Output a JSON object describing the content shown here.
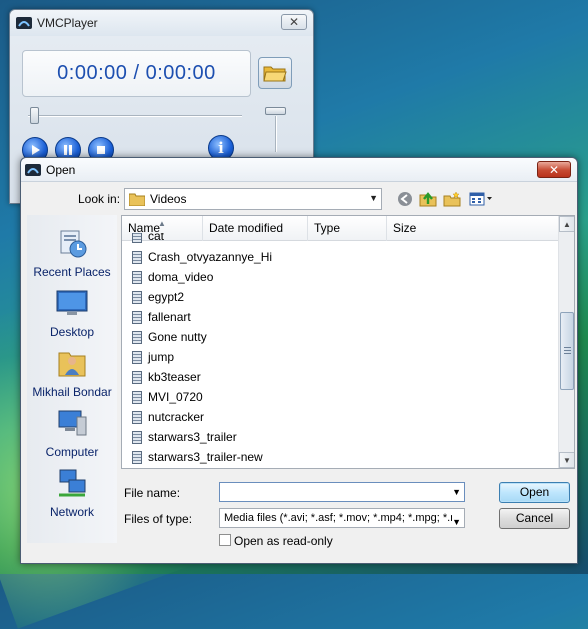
{
  "player": {
    "title": "VMCPlayer",
    "close_label": "✕",
    "time_display": "0:00:00 / 0:00:00",
    "seek_position": 0,
    "volume_level": 1.0,
    "info_label": "i",
    "controls": [
      "play-icon",
      "pause-icon",
      "stop-icon",
      "info-icon",
      "open-folder-icon"
    ]
  },
  "dialog": {
    "title": "Open",
    "close_label": "✕",
    "look_in_label": "Look in:",
    "look_in_value": "Videos",
    "places": [
      {
        "label": "Recent Places",
        "icon": "recent-places-icon"
      },
      {
        "label": "Desktop",
        "icon": "desktop-icon"
      },
      {
        "label": "Mikhail Bondar",
        "icon": "user-folder-icon"
      },
      {
        "label": "Computer",
        "icon": "computer-icon"
      },
      {
        "label": "Network",
        "icon": "network-icon"
      }
    ],
    "columns": [
      "Name",
      "Date modified",
      "Type",
      "Size"
    ],
    "files": [
      "cat",
      "Crash_otvyazannye_Hi",
      "doma_video",
      "egypt2",
      "fallenart",
      "Gone nutty",
      "jump",
      "kb3teaser",
      "MVI_0720",
      "nutcracker",
      "starwars3_trailer",
      "starwars3_trailer-new"
    ],
    "file_name_label": "File name:",
    "file_name_value": "",
    "files_of_type_label": "Files of type:",
    "files_of_type_value": "Media files (*.avi; *.asf; *.mov; *.mp4; *.mpg; *.m",
    "read_only_label": "Open as read-only",
    "read_only_checked": false,
    "open_button": "Open",
    "cancel_button": "Cancel"
  }
}
